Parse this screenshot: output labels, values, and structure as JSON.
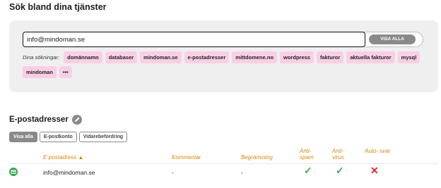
{
  "page": {
    "title": "Sök bland dina tjänster"
  },
  "search": {
    "value": "info@mindoman.se",
    "show_all_label": "VISA ALLA",
    "label": "Dina sökningar:",
    "chips": [
      "domännamn",
      "databaser",
      "mindoman.se",
      "e-postadresser",
      "mittdomene.no",
      "wordpress",
      "fakturor",
      "aktuella fakturor",
      "mysql",
      "mindoman",
      "•••"
    ]
  },
  "section": {
    "title": "E-postadresser",
    "tabs": [
      "Visa alla",
      "E-postkonto",
      "Vidarebefordring"
    ]
  },
  "table": {
    "headers": {
      "email": "E-postadress ▲",
      "comment": "Kommentar",
      "limit": "Begränsning",
      "antispam": "Anti-\nspam",
      "antivirus": "Anti-\nvirus",
      "autoreply": "Auto- svar"
    },
    "row": {
      "email": "info@mindoman.se",
      "comment": "-",
      "limit": "-",
      "antispam": "✓",
      "antivirus": "✓",
      "autoreply": "✕"
    }
  },
  "colors": {
    "accent": "#d4880c",
    "chip": "#f9cfe6",
    "check": "#37b24d",
    "cross": "#e5262d"
  }
}
